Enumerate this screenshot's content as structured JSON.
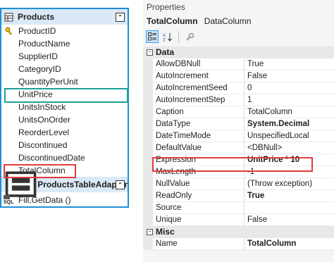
{
  "designer": {
    "table": {
      "title": "Products",
      "columns": [
        "ProductID",
        "ProductName",
        "SupplierID",
        "CategoryID",
        "QuantityPerUnit",
        "UnitPrice",
        "UnitsInStock",
        "UnitsOnOrder",
        "ReorderLevel",
        "Discontinued",
        "DiscontinuedDate",
        "TotalColumn"
      ],
      "key_column": "ProductID",
      "highlight_green": "UnitPrice",
      "highlight_red": "TotalColumn"
    },
    "adapter": {
      "title": "ProductsTableAdapter",
      "method_icon": "SQL",
      "method": "Fill,GetData ()"
    }
  },
  "properties": {
    "window_title": "Properties",
    "object_name": "TotalColumn",
    "object_type": "DataColumn",
    "categories": [
      {
        "name": "Data",
        "rows": [
          {
            "name": "AllowDBNull",
            "value": "True",
            "bold": false
          },
          {
            "name": "AutoIncrement",
            "value": "False",
            "bold": false
          },
          {
            "name": "AutoIncrementSeed",
            "value": "0",
            "bold": false
          },
          {
            "name": "AutoIncrementStep",
            "value": "1",
            "bold": false
          },
          {
            "name": "Caption",
            "value": "TotalColumn",
            "bold": false
          },
          {
            "name": "DataType",
            "value": "System.Decimal",
            "bold": true
          },
          {
            "name": "DateTimeMode",
            "value": "UnspecifiedLocal",
            "bold": false
          },
          {
            "name": "DefaultValue",
            "value": "<DBNull>",
            "bold": false
          },
          {
            "name": "Expression",
            "value": "UnitPrice * 10",
            "bold": true
          },
          {
            "name": "MaxLength",
            "value": "-1",
            "bold": false
          },
          {
            "name": "NullValue",
            "value": "(Throw exception)",
            "bold": false
          },
          {
            "name": "ReadOnly",
            "value": "True",
            "bold": true
          },
          {
            "name": "Source",
            "value": "",
            "bold": false
          },
          {
            "name": "Unique",
            "value": "False",
            "bold": false
          }
        ]
      },
      {
        "name": "Misc",
        "rows": [
          {
            "name": "Name",
            "value": "TotalColumn",
            "bold": true
          }
        ]
      }
    ],
    "highlight_row": "Expression"
  },
  "colors": {
    "designer_border": "#1e8fd6",
    "header_bg": "#dbe8f6",
    "green_highlight": "#1aa39a",
    "red_highlight": "#e23b3b"
  }
}
